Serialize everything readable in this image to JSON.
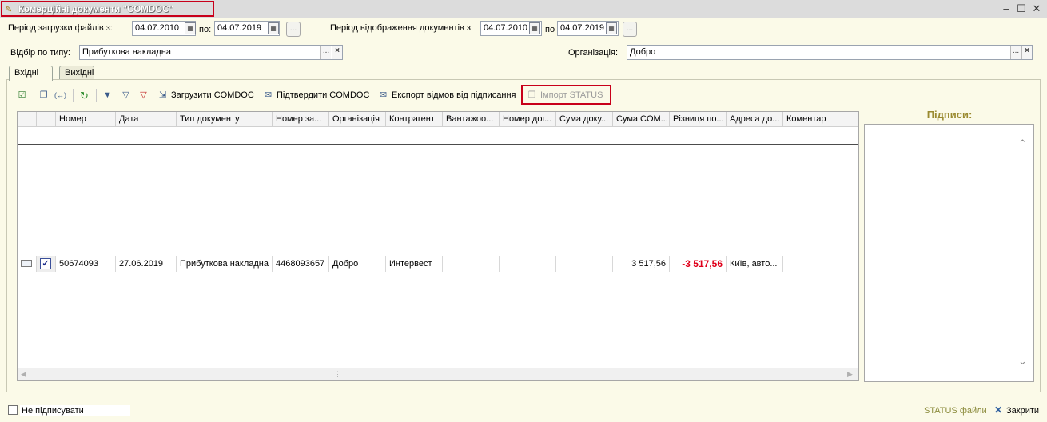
{
  "window": {
    "title": "Комерційні документи \"COMDOC\"",
    "controls": [
      "minimize-icon",
      "maximize-icon",
      "close-icon"
    ]
  },
  "filters": {
    "load_period_label": "Період загрузки файлів з:",
    "load_from": "04.07.2010",
    "to_label": "по:",
    "load_to": "04.07.2019",
    "ellipsis": "...",
    "display_period_label": "Період відображення документів з",
    "display_from": "04.07.2010",
    "display_to_label": "по",
    "display_to": "04.07.2019",
    "type_label": "Відбір по типу:",
    "type_value": "Прибуткова накладна",
    "org_label": "Організація:",
    "org_value": "Добро",
    "clear_symbol": "×"
  },
  "tabs": [
    {
      "label": "Вхідні",
      "active": true
    },
    {
      "label": "Вихідні",
      "active": false
    }
  ],
  "toolbar": {
    "load_comdoc": "Загрузити COMDOC",
    "confirm_comdoc": "Підтвердити COMDOC",
    "export_refusals": "Експорт відмов від підписання",
    "import_status": "Імпорт STATUS"
  },
  "table": {
    "columns": [
      "Номер",
      "Дата",
      "Тип документу",
      "Номер за...",
      "Організація",
      "Контрагент",
      "Вантажоо...",
      "Номер дог...",
      "Сума доку...",
      "Сума COM...",
      "Різниця по...",
      "Адреса до...",
      "Коментар"
    ],
    "rows": [
      {
        "number": "50674093",
        "date": "27.06.2019",
        "doc_type": "Прибуткова накладна",
        "order_number": "4468093657",
        "organization": "Добро",
        "counterparty": "Интервест",
        "consignee": "",
        "contract_number": "",
        "doc_sum": "",
        "comdoc_sum": "3 517,56",
        "difference": "-3 517,56",
        "address": "Київ, авто...",
        "comment": ""
      }
    ]
  },
  "signatures": {
    "title": "Підписи:"
  },
  "footer": {
    "dont_sign": "Не підписувати",
    "status_files": "STATUS файли",
    "close": "Закрити"
  },
  "colors": {
    "accent_red": "#c8001a",
    "negative_value": "#e0001b",
    "signatures_title": "#9a8a30",
    "background": "#fbfae8"
  }
}
